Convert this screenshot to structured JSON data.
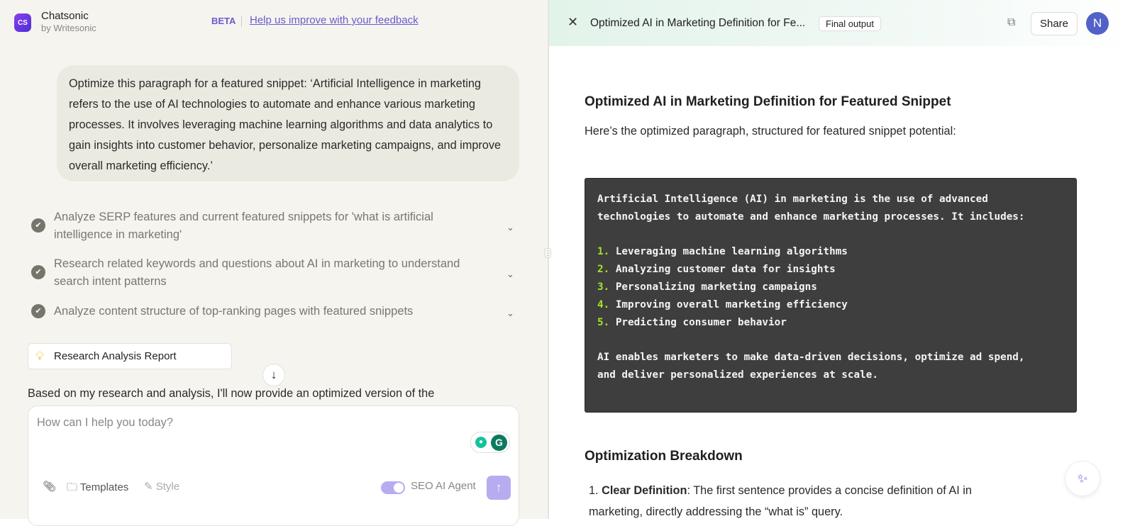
{
  "header": {
    "brand": "Chatsonic",
    "brand_sub": "by Writesonic",
    "logo_text": "CS",
    "beta": "BETA",
    "feedback_link": "Help us improve with your feedback"
  },
  "chat": {
    "user_message": "Optimize this paragraph for a featured snippet: ‘Artificial Intelligence in marketing refers to the use of AI technologies to automate and enhance various marketing processes. It involves leveraging machine learning algorithms and data analytics to gain insights into customer behavior, personalize marketing campaigns, and improve overall marketing efficiency.’",
    "steps": [
      {
        "text": "Analyze SERP features and current featured snippets for 'what is artificial intelligence in marketing'",
        "status": "done"
      },
      {
        "text": "Research related keywords and questions about AI in marketing to understand search intent patterns",
        "status": "done"
      },
      {
        "text": "Analyze content structure of top-ranking pages with featured snippets",
        "status": "done"
      }
    ],
    "report_chip": "Research Analysis Report",
    "assistant_partial": "Based on my research and analysis, I'll now provide an optimized version of the"
  },
  "composer": {
    "placeholder": "How can I help you today?",
    "templates": "Templates",
    "style": "Style",
    "agent_label": "SEO AI Agent",
    "agent_enabled": true
  },
  "panel": {
    "title": "Optimized AI in Marketing Definition for Fe...",
    "badge": "Final output",
    "share": "Share",
    "avatar": "N",
    "heading": "Optimized AI in Marketing Definition for Featured Snippet",
    "intro": "Here’s the optimized paragraph, structured for featured snippet potential:",
    "code_lines": [
      "Artificial Intelligence (AI) in marketing is the use of advanced",
      "technologies to automate and enhance marketing processes. It includes:"
    ],
    "code_list": [
      "Leveraging machine learning algorithms",
      "Analyzing customer data for insights",
      "Personalizing marketing campaigns",
      "Improving overall marketing efficiency",
      "Predicting consumer behavior"
    ],
    "code_outro": [
      "AI enables marketers to make data-driven decisions, optimize ad spend,",
      "and deliver personalized experiences at scale."
    ],
    "breakdown_heading": "Optimization Breakdown",
    "breakdown_items": [
      {
        "term": "Clear Definition",
        "text": ": The first sentence provides a concise definition of AI in marketing, directly addressing the “what is” query."
      }
    ]
  },
  "colors": {
    "accent": "#6a5acd",
    "code_bg": "#3e3e3e",
    "code_number": "#a6e22e",
    "left_bg": "#f5f4ef"
  }
}
